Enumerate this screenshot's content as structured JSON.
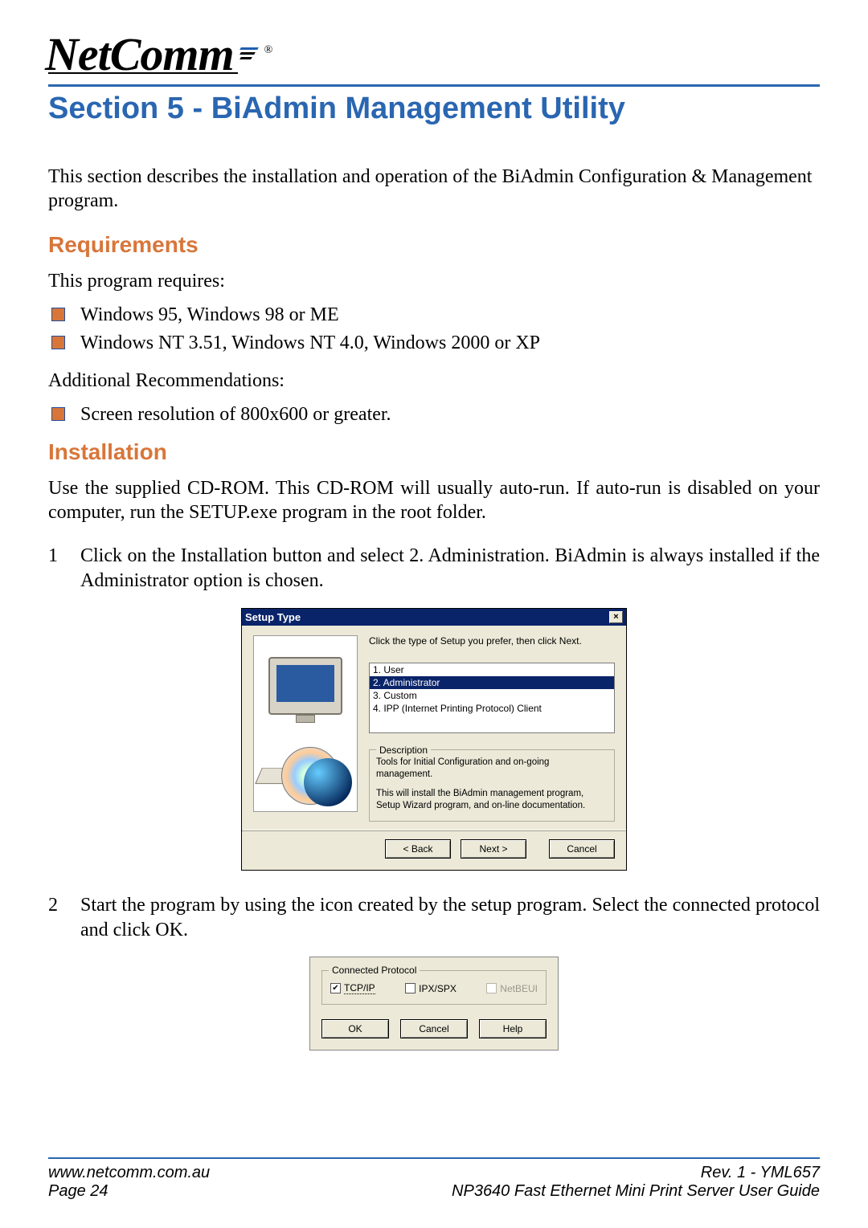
{
  "logo": {
    "brand": "NetComm",
    "reg": "®"
  },
  "title": "Section 5 - BiAdmin Management Utility",
  "intro": "This section describes the installation and operation of the BiAdmin Configuration & Management program.",
  "requirements": {
    "heading": "Requirements",
    "lead": "This program requires:",
    "items": [
      "Windows 95, Windows 98 or ME",
      "Windows NT 3.51, Windows NT 4.0, Windows 2000 or XP"
    ],
    "additional_lead": "Additional Recommendations:",
    "additional_items": [
      "Screen resolution of 800x600 or greater."
    ]
  },
  "installation": {
    "heading": "Installation",
    "lead": "Use the supplied CD-ROM. This CD-ROM will usually auto-run. If auto-run is disabled on your computer, run the SETUP.exe program in the root folder.",
    "steps": [
      "Click on the Installation button and select 2. Administration.  BiAdmin is always installed if the Administrator option is chosen.",
      "Start the program by using the icon created by the setup program.  Select the connected protocol and click OK."
    ]
  },
  "setup_dialog": {
    "title": "Setup Type",
    "close": "×",
    "prompt": "Click the type of Setup you prefer, then click Next.",
    "options": [
      "1. User",
      "2. Administrator",
      "3. Custom",
      "4. IPP (Internet Printing Protocol) Client"
    ],
    "selected_index": 1,
    "desc_legend": "Description",
    "desc_line1": "Tools for Initial Configuration and on-going management.",
    "desc_line2": "This will install the BiAdmin management program, Setup Wizard program, and on-line documentation.",
    "back": "< Back",
    "next": "Next >",
    "cancel": "Cancel"
  },
  "protocol_dialog": {
    "legend": "Connected Protocol",
    "tcpip": "TCP/IP",
    "ipxspx": "IPX/SPX",
    "netbeui": "NetBEUI",
    "ok": "OK",
    "cancel": "Cancel",
    "help": "Help"
  },
  "footer": {
    "url": "www.netcomm.com.au",
    "rev": "Rev. 1 - YML657",
    "page": "Page 24",
    "guide": "NP3640  Fast Ethernet Mini Print Server User Guide"
  }
}
